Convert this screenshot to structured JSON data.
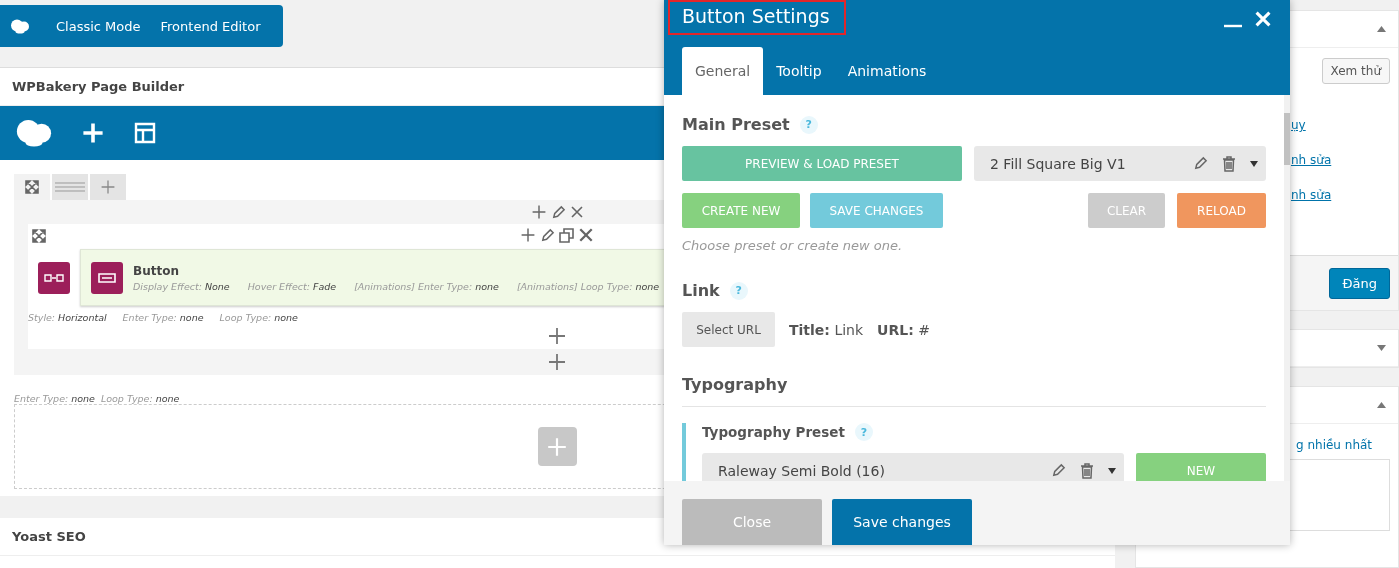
{
  "editor_toggle": {
    "buttons": [
      {
        "label": "Classic Mode"
      },
      {
        "label": "Frontend Editor"
      }
    ]
  },
  "builder": {
    "title": "WPBakery Page Builder",
    "row": {
      "column": {
        "element": {
          "title": "Button",
          "params": [
            {
              "label": "Display Effect:",
              "value": "None"
            },
            {
              "label": "Hover Effect:",
              "value": "Fade"
            },
            {
              "label": "[Animations] Enter Type:",
              "value": "none"
            },
            {
              "label": "[Animations] Loop Type:",
              "value": "none"
            }
          ]
        },
        "params": [
          {
            "label": "Style:",
            "value": "Horizontal"
          },
          {
            "label": "Enter Type:",
            "value": "none"
          },
          {
            "label": "Loop Type:",
            "value": "none"
          }
        ]
      }
    },
    "footer_params": [
      {
        "label": "Enter Type:",
        "value": "none"
      },
      {
        "label": "Loop Type:",
        "value": "none"
      }
    ]
  },
  "yoast": {
    "title": "Yoast SEO"
  },
  "sidebar": {
    "panels": [
      {
        "expanded": true
      },
      {
        "expanded": false
      },
      {
        "expanded": true
      }
    ],
    "preview_button": "Xem thử",
    "links": [
      "ụy",
      "nh sửa",
      "nh sửa"
    ],
    "publish_button": "Đăng",
    "category_text": "g nhiều nhất"
  },
  "modal": {
    "title": "Button Settings",
    "tabs": [
      {
        "label": "General",
        "selected": true
      },
      {
        "label": "Tooltip",
        "selected": false
      },
      {
        "label": "Animations",
        "selected": false
      }
    ],
    "main_preset": {
      "heading": "Main Preset",
      "help": "?",
      "load_button": "PREVIEW & LOAD PRESET",
      "preset_select": "2 Fill Square Big V1",
      "create_button": "CREATE NEW",
      "save_button": "SAVE CHANGES",
      "clear_button": "CLEAR",
      "reload_button": "RELOAD",
      "hint": "Choose preset or create new one."
    },
    "link": {
      "heading": "Link",
      "help": "?",
      "select_button": "Select URL",
      "title_text": "**Title:** Link",
      "url_text": "**URL:** #"
    },
    "typography": {
      "heading": "Typography",
      "preset_label": "Typography Preset",
      "help": "?",
      "preset_select": "Raleway Semi Bold (16)",
      "new_button": "NEW"
    },
    "footer": {
      "close_button": "Close",
      "save_button": "Save changes"
    }
  }
}
